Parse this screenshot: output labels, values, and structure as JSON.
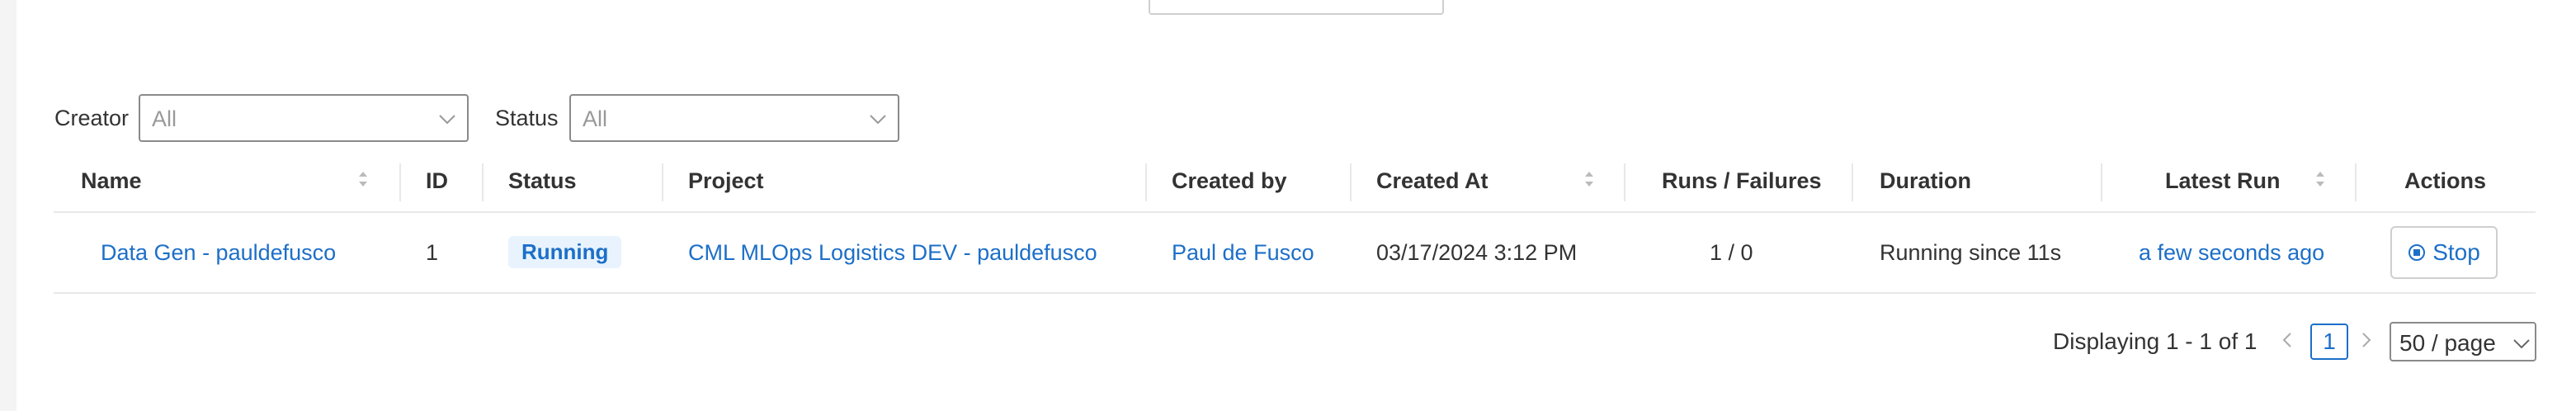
{
  "filters": {
    "creator_label": "Creator",
    "creator_value": "All",
    "status_label": "Status",
    "status_value": "All"
  },
  "table": {
    "headers": {
      "name": "Name",
      "id": "ID",
      "status": "Status",
      "project": "Project",
      "created_by": "Created by",
      "created_at": "Created At",
      "runs_failures": "Runs / Failures",
      "duration": "Duration",
      "latest_run": "Latest Run",
      "actions": "Actions"
    },
    "rows": [
      {
        "name": "Data Gen - pauldefusco",
        "id": "1",
        "status": "Running",
        "project": "CML MLOps Logistics DEV - pauldefusco",
        "created_by": "Paul de Fusco",
        "created_at": "03/17/2024 3:12 PM",
        "runs_failures": "1 / 0",
        "duration": "Running since 11s",
        "latest_run": "a few seconds ago",
        "action": "Stop"
      }
    ]
  },
  "pagination": {
    "summary": "Displaying 1 - 1 of 1",
    "current_page": "1",
    "page_size": "50 / page"
  },
  "colors": {
    "accent": "#1c6fc8",
    "badge_bg": "#e8f3fd",
    "border": "#e8e8e8"
  },
  "icons": {
    "stop": "stop-circle-icon",
    "sort": "sort-icon",
    "dropdown": "chevron-down-icon",
    "prev": "chevron-left-icon",
    "next": "chevron-right-icon"
  }
}
